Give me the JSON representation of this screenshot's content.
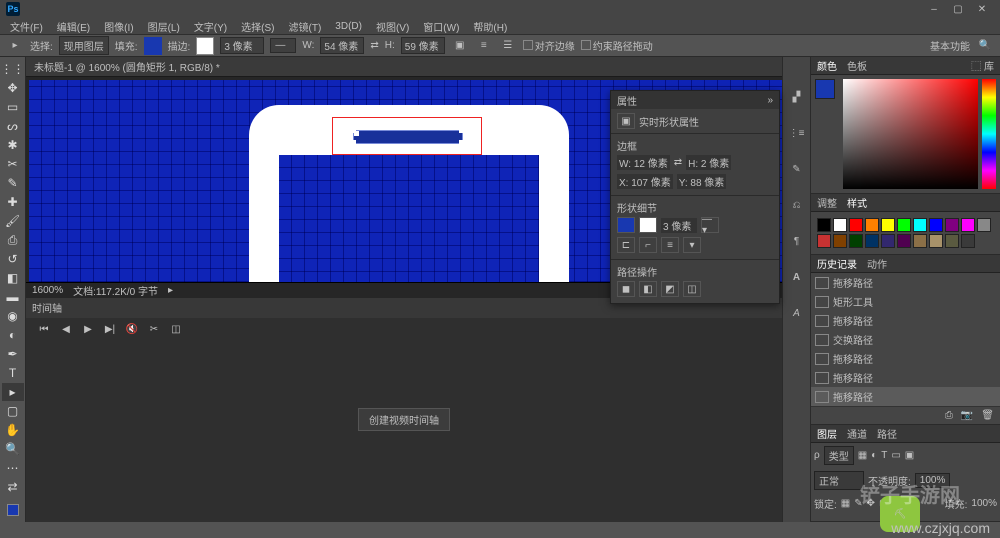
{
  "titlebar": {
    "window_controls": {
      "min": "–",
      "max": "▢",
      "close": "✕"
    }
  },
  "menu": [
    "文件(F)",
    "编辑(E)",
    "图像(I)",
    "图层(L)",
    "文字(Y)",
    "选择(S)",
    "滤镜(T)",
    "3D(D)",
    "视图(V)",
    "窗口(W)",
    "帮助(H)"
  ],
  "options": {
    "select_label": "选择:",
    "select_value": "现用图层",
    "fill_label": "填充:",
    "stroke_label": "描边:",
    "stroke_val": "3 像素",
    "w_label": "W:",
    "w_val": "54 像素",
    "h_label": "H:",
    "h_val": "59 像素",
    "align_edges": "对齐边缘",
    "constrain": "约束路径拖动",
    "workspace": "基本功能"
  },
  "doc": {
    "tab": "未标题-1 @ 1600% (圆角矩形 1, RGB/8) *",
    "zoom": "1600%",
    "filesize": "文档:117.2K/0 字节"
  },
  "props": {
    "title": "属性",
    "shape_title": "实时形状属性",
    "section_bb": "边框",
    "w": "W: 12 像素",
    "h": "H: 2 像素",
    "x": "X: 107 像素",
    "y": "Y: 88 像素",
    "shape_detail": "形状细节",
    "stroke": "3 像素",
    "path_ops": "路径操作"
  },
  "panels": {
    "color_tab": "颜色",
    "swatches_tab": "色板",
    "lib_tab": "库",
    "adjust_tab": "调整",
    "styles_tab": "样式",
    "history_tab": "历史记录",
    "actions_tab": "动作",
    "history": [
      "拖移路径",
      "矩形工具",
      "拖移路径",
      "交换路径",
      "拖移路径",
      "拖移路径",
      "拖移路径"
    ],
    "layers_tab": "图层",
    "channels_tab": "通道",
    "paths_tab": "路径",
    "kind": "类型",
    "blend": "正常",
    "opacity_label": "不透明度:",
    "opacity": "100%",
    "lock_label": "锁定:",
    "fill_label": "填充:",
    "fill": "100%"
  },
  "timeline": {
    "tab": "时间轴",
    "create": "创建视频时间轴"
  },
  "swatches": [
    "#000",
    "#fff",
    "#f00",
    "#ff8000",
    "#ff0",
    "#0f0",
    "#0ff",
    "#00f",
    "#800080",
    "#f0f",
    "#888",
    "#c83232",
    "#804000",
    "#004000",
    "#003264",
    "#32286e",
    "#500050",
    "#8b6f47",
    "#a8926a",
    "#5a5a40",
    "#3a3a3a"
  ]
}
